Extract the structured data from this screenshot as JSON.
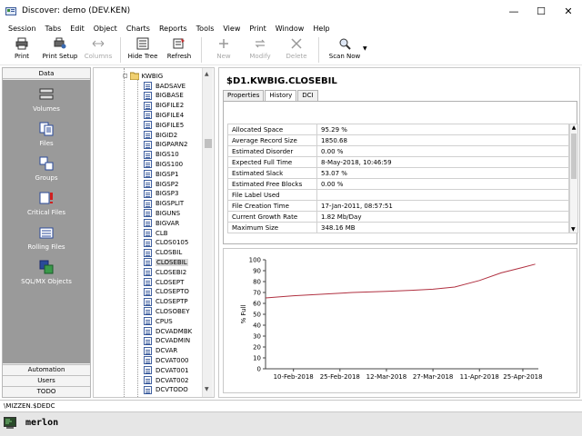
{
  "window": {
    "title": "Discover: demo (DEV.KEN)",
    "controls": {
      "minimize": "—",
      "maximize": "☐",
      "close": "✕"
    }
  },
  "menu": [
    "Session",
    "Tabs",
    "Edit",
    "Object",
    "Charts",
    "Reports",
    "Tools",
    "View",
    "Print",
    "Window",
    "Help"
  ],
  "toolbar": {
    "print": "Print",
    "print_setup": "Print Setup",
    "columns": "Columns",
    "hide_tree": "Hide Tree",
    "refresh": "Refresh",
    "new": "New",
    "modify": "Modify",
    "delete": "Delete",
    "scan_now": "Scan Now"
  },
  "nav": {
    "header": "Data",
    "items": [
      "Volumes",
      "Files",
      "Groups",
      "Critical Files",
      "Rolling Files",
      "SQL/MX Objects"
    ],
    "footer": [
      "Automation",
      "Users",
      "TODO"
    ]
  },
  "tree": {
    "root": "KWBIG",
    "items": [
      "BADSAVE",
      "BIGBASE",
      "BIGFILE2",
      "BIGFILE4",
      "BIGFILE5",
      "BIGID2",
      "BIGPARN2",
      "BIGS10",
      "BIGS100",
      "BIGSP1",
      "BIGSP2",
      "BIGSP3",
      "BIGSPLIT",
      "BIGUNS",
      "BIGVAR",
      "CLB",
      "CLOS0105",
      "CLOSBIL",
      "CLOSEBIL",
      "CLOSEBI2",
      "CLOSEPT",
      "CLOSEPTO",
      "CLOSEPTP",
      "CLOSOBEY",
      "CPUS",
      "DCVADMBK",
      "DCVADMIN",
      "DCVAR",
      "DCVAT000",
      "DCVAT001",
      "DCVAT002",
      "DCVTODO"
    ],
    "selected": "CLOSEBIL"
  },
  "detail": {
    "title": "$D1.KWBIG.CLOSEBIL",
    "tabs": [
      "Properties",
      "History",
      "DCI"
    ],
    "active_tab": "History",
    "properties": [
      {
        "name": "Allocated Space",
        "value": "95.29 %"
      },
      {
        "name": "Average Record Size",
        "value": "1850.68"
      },
      {
        "name": "Estimated Disorder",
        "value": "0.00 %"
      },
      {
        "name": "Expected Full Time",
        "value": "8-May-2018, 10:46:59"
      },
      {
        "name": "Estimated Slack",
        "value": "53.07 %"
      },
      {
        "name": "Estimated Free Blocks",
        "value": "0.00 %"
      },
      {
        "name": "File Label Used",
        "value": ""
      },
      {
        "name": "File Creation Time",
        "value": "17-Jan-2011, 08:57:51"
      },
      {
        "name": "Current Growth Rate",
        "value": "1.82 Mb/Day"
      },
      {
        "name": "Maximum Size",
        "value": "348.16 MB"
      }
    ]
  },
  "chart_data": {
    "type": "line",
    "ylabel": "% Full",
    "xlabel": "",
    "ylim": [
      0,
      100
    ],
    "yticks": [
      0,
      10,
      20,
      30,
      40,
      50,
      60,
      70,
      80,
      90,
      100
    ],
    "xlim": [
      "2018-02-01",
      "2018-04-30"
    ],
    "xticks": [
      "10-Feb-2018",
      "25-Feb-2018",
      "12-Mar-2018",
      "27-Mar-2018",
      "11-Apr-2018",
      "25-Apr-2018"
    ],
    "xtick_dates": [
      "2018-02-10",
      "2018-02-25",
      "2018-03-12",
      "2018-03-27",
      "2018-04-11",
      "2018-04-25"
    ],
    "grid": false,
    "series": [
      {
        "color": "#b03040",
        "x": [
          "2018-02-01",
          "2018-02-10",
          "2018-02-20",
          "2018-03-01",
          "2018-03-12",
          "2018-03-20",
          "2018-03-27",
          "2018-04-03",
          "2018-04-11",
          "2018-04-18",
          "2018-04-25",
          "2018-04-29"
        ],
        "y": [
          65,
          67,
          68.5,
          70,
          71,
          72,
          73,
          75,
          81,
          88,
          93,
          96
        ]
      }
    ]
  },
  "status": {
    "path": "\\MIZZEN.$DEDC"
  },
  "taskbar": {
    "label": "merlon"
  }
}
